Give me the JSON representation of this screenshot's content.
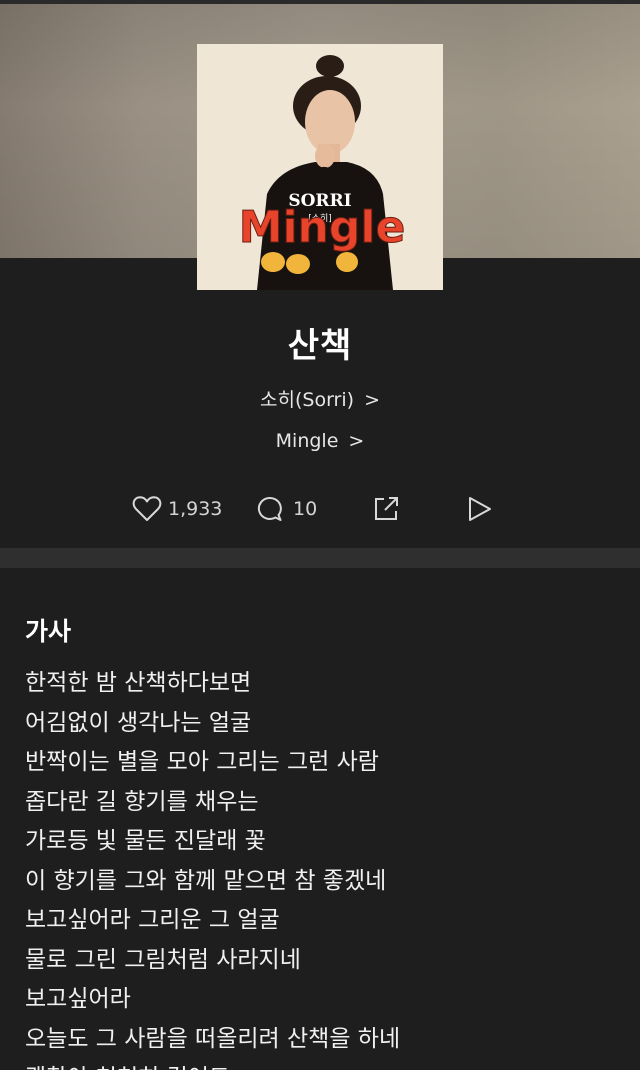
{
  "song": {
    "title": "산책",
    "artist_label": "소히(Sorri)",
    "album_label": "Mingle",
    "chevron": ">"
  },
  "album_art": {
    "artist_text": "SORRI",
    "artist_sub": "[소히]",
    "album_text": "Mingle"
  },
  "actions": {
    "like_count": "1,933",
    "comment_count": "10"
  },
  "lyrics": {
    "heading": "가사",
    "lines": [
      "한적한 밤 산책하다보면",
      "어김없이 생각나는 얼굴",
      "반짝이는 별을 모아 그리는 그런 사람",
      "좁다란 길 향기를 채우는",
      "가로등 빛 물든 진달래 꽃",
      "이 향기를 그와 함께 맡으면 참 좋겠네",
      "보고싶어라 그리운 그 얼굴",
      "물로 그린 그림처럼 사라지네",
      "보고싶어라",
      "오늘도 그 사람을 떠올리려 산책을 하네",
      "괜찮아 천천히 걸어도"
    ]
  },
  "colors": {
    "background": "#1e1e1e",
    "divider": "#2f2f2f",
    "text": "#ffffff"
  }
}
